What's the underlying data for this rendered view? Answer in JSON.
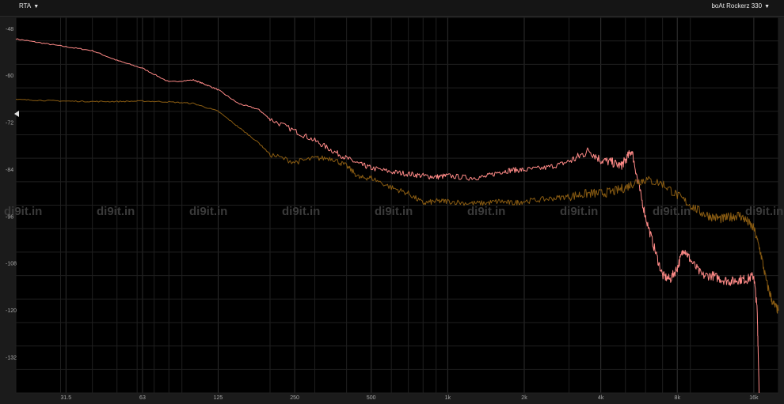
{
  "header": {
    "mode_label": "RTA",
    "device_label": "boAt Rockerz 330"
  },
  "icons": {
    "dropdown": "caret-down-icon",
    "marker": "triangle-left-icon"
  },
  "watermark": "di9it.in",
  "colors": {
    "background": "#000000",
    "grid": "#2e2e2e",
    "series_1": "#ff8a87",
    "series_2": "#8a5c12",
    "watermark": "#3a3a3a"
  },
  "chart_data": {
    "type": "line",
    "x_scale": "log",
    "xlim": [
      20,
      20000
    ],
    "ylim": [
      -140,
      -44
    ],
    "grid": true,
    "x_ticks": [
      31.5,
      63,
      125,
      250,
      500,
      1000,
      2000,
      4000,
      8000,
      16000
    ],
    "x_tick_labels": [
      "31.5",
      "63",
      "125",
      "250",
      "500",
      "1k",
      "2k",
      "4k",
      "8k",
      "16k"
    ],
    "y_ticks": [
      -48,
      -60,
      -72,
      -84,
      -96,
      -108,
      -120,
      -132
    ],
    "y_tick_labels": [
      "-48",
      "-60",
      "-72",
      "-84",
      "-96",
      "-108",
      "-120",
      "-132"
    ],
    "series": [
      {
        "color": "#ff8a87",
        "x": [
          20,
          25,
          31.5,
          40,
          50,
          63,
          80,
          100,
          110,
          125,
          150,
          180,
          200,
          250,
          300,
          350,
          400,
          450,
          500,
          600,
          700,
          800,
          900,
          1000,
          1200,
          1400,
          1600,
          1800,
          2000,
          2400,
          2800,
          3200,
          3600,
          4000,
          4400,
          4800,
          5000,
          5300,
          5600,
          6000,
          6500,
          7000,
          7500,
          8000,
          8500,
          9000,
          10000,
          11000,
          12000,
          13000,
          14000,
          15000,
          16000,
          16500,
          16800
        ],
        "y": [
          -49.5,
          -50.5,
          -51.5,
          -52.5,
          -55,
          -57,
          -60.5,
          -60,
          -61,
          -62.5,
          -66,
          -67.5,
          -70,
          -73,
          -75.5,
          -78,
          -80,
          -81.5,
          -82.5,
          -83.5,
          -84,
          -84.5,
          -84.8,
          -84.5,
          -85,
          -84.8,
          -83.5,
          -83,
          -83,
          -82.5,
          -81.5,
          -80,
          -78,
          -80.5,
          -81,
          -82,
          -80.5,
          -78,
          -86,
          -95,
          -103,
          -110,
          -111,
          -108,
          -103,
          -106,
          -110,
          -110,
          -111,
          -111.5,
          -111,
          -111,
          -110,
          -119,
          -140
        ]
      },
      {
        "color": "#8a5c12",
        "x": [
          20,
          25,
          31.5,
          40,
          50,
          63,
          80,
          100,
          125,
          150,
          180,
          200,
          250,
          300,
          350,
          400,
          450,
          500,
          600,
          700,
          800,
          900,
          1000,
          1200,
          1400,
          1600,
          1800,
          2000,
          2400,
          2800,
          3200,
          3600,
          4000,
          4500,
          5000,
          5500,
          6000,
          7000,
          8000,
          9000,
          10000,
          11000,
          12000,
          13000,
          14000,
          15000,
          16000,
          17000,
          18000,
          19000,
          20000
        ],
        "y": [
          -65,
          -65.2,
          -65.4,
          -65.5,
          -65.5,
          -65.4,
          -65.6,
          -66,
          -68,
          -72,
          -76,
          -79,
          -81,
          -80,
          -80,
          -82,
          -85,
          -85,
          -87.5,
          -89,
          -91.5,
          -91,
          -91,
          -91.5,
          -91.5,
          -91,
          -91.5,
          -91,
          -90.5,
          -90,
          -89.5,
          -89,
          -89,
          -88.5,
          -87.5,
          -86,
          -85.5,
          -86.5,
          -89.5,
          -92,
          -94,
          -95,
          -95.5,
          -95,
          -94.5,
          -96,
          -98,
          -104,
          -112,
          -117,
          -119
        ]
      }
    ]
  }
}
